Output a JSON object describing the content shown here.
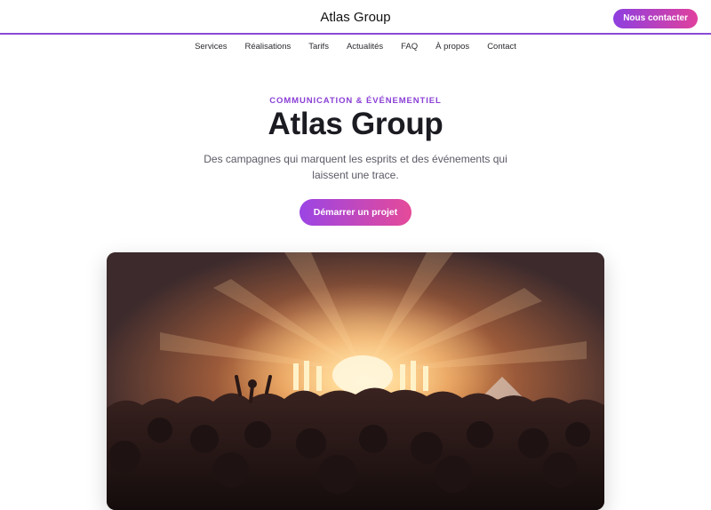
{
  "header": {
    "brand": "Atlas Group",
    "cta_label": "Nous contacter"
  },
  "nav": {
    "items": [
      {
        "label": "Services"
      },
      {
        "label": "Réalisations"
      },
      {
        "label": "Tarifs"
      },
      {
        "label": "Actualités"
      },
      {
        "label": "FAQ"
      },
      {
        "label": "À propos"
      },
      {
        "label": "Contact"
      }
    ]
  },
  "hero": {
    "eyebrow": "COMMUNICATION & ÉVÉNEMENTIEL",
    "title": "Atlas Group",
    "subtitle": "Des campagnes qui marquent les esprits et des événements qui laissent une trace.",
    "cta_label": "Démarrer un projet",
    "image_icon": "concert-photo"
  },
  "colors": {
    "accent_start": "#8e3fe0",
    "accent_end": "#e0409d",
    "eyebrow": "#8a3fd6",
    "header_border": "#8a4bd6"
  }
}
